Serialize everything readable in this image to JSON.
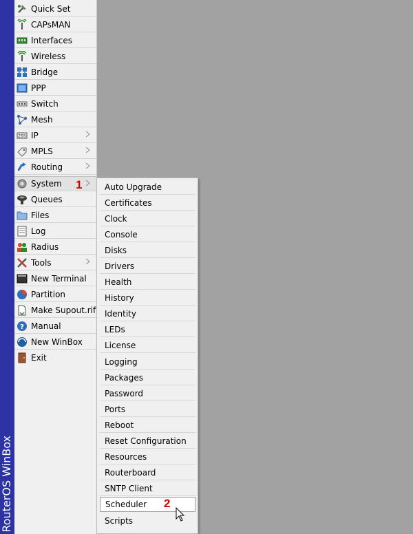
{
  "brand": "RouterOS WinBox",
  "menu": {
    "items": [
      {
        "label": "Quick Set",
        "icon": "quick-set-icon"
      },
      {
        "label": "CAPsMAN",
        "icon": "capsman-icon"
      },
      {
        "label": "Interfaces",
        "icon": "interfaces-icon"
      },
      {
        "label": "Wireless",
        "icon": "wireless-icon"
      },
      {
        "label": "Bridge",
        "icon": "bridge-icon"
      },
      {
        "label": "PPP",
        "icon": "ppp-icon"
      },
      {
        "label": "Switch",
        "icon": "switch-icon"
      },
      {
        "label": "Mesh",
        "icon": "mesh-icon"
      },
      {
        "label": "IP",
        "icon": "ip-icon",
        "submenu": true
      },
      {
        "label": "MPLS",
        "icon": "mpls-icon",
        "submenu": true
      },
      {
        "label": "Routing",
        "icon": "routing-icon",
        "submenu": true
      },
      {
        "label": "System",
        "icon": "system-icon",
        "submenu": true,
        "selected": true
      },
      {
        "label": "Queues",
        "icon": "queues-icon"
      },
      {
        "label": "Files",
        "icon": "files-icon"
      },
      {
        "label": "Log",
        "icon": "log-icon"
      },
      {
        "label": "Radius",
        "icon": "radius-icon"
      },
      {
        "label": "Tools",
        "icon": "tools-icon",
        "submenu": true
      },
      {
        "label": "New Terminal",
        "icon": "terminal-icon"
      },
      {
        "label": "Partition",
        "icon": "partition-icon"
      },
      {
        "label": "Make Supout.rif",
        "icon": "supout-icon"
      },
      {
        "label": "Manual",
        "icon": "manual-icon"
      },
      {
        "label": "New WinBox",
        "icon": "winbox-icon"
      },
      {
        "label": "Exit",
        "icon": "exit-icon"
      }
    ]
  },
  "system_submenu": {
    "items": [
      "Auto Upgrade",
      "Certificates",
      "Clock",
      "Console",
      "Disks",
      "Drivers",
      "Health",
      "History",
      "Identity",
      "LEDs",
      "License",
      "Logging",
      "Packages",
      "Password",
      "Ports",
      "Reboot",
      "Reset Configuration",
      "Resources",
      "Routerboard",
      "SNTP Client",
      "Scheduler",
      "Scripts"
    ],
    "hovered": "Scheduler"
  },
  "annotations": {
    "step1": "1",
    "step2": "2"
  },
  "colors": {
    "sidebar": "#2d33a5",
    "desktop": "#a3a2a3",
    "annotation": "#d00000"
  }
}
